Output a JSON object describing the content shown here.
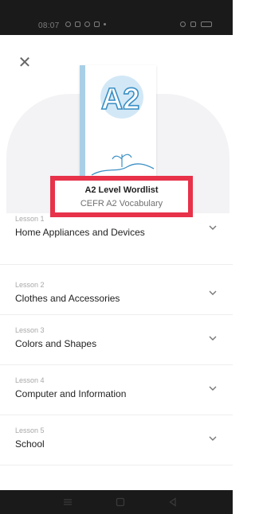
{
  "status_bar": {
    "time": "08:07",
    "left_icons": [
      "whatsapp-icon",
      "message-icon",
      "messenger-icon",
      "instagram-icon",
      "dot-icon"
    ],
    "right_icons": [
      "alarm-icon",
      "signal-icon",
      "battery-icon"
    ]
  },
  "header": {
    "close_icon": "close-icon",
    "cover_badge": "A2",
    "title": "A2 Level Wordlist",
    "subtitle": "CEFR A2 Vocabulary",
    "highlight_color": "#e7324a"
  },
  "lessons": [
    {
      "number": "Lesson 1",
      "title": "Home Appliances and Devices"
    },
    {
      "number": "Lesson 2",
      "title": "Clothes and Accessories"
    },
    {
      "number": "Lesson 3",
      "title": "Colors and Shapes"
    },
    {
      "number": "Lesson 4",
      "title": "Computer and Information"
    },
    {
      "number": "Lesson 5",
      "title": "School"
    }
  ],
  "nav_bar": {
    "buttons": [
      "menu-icon",
      "home-icon",
      "back-icon"
    ]
  }
}
